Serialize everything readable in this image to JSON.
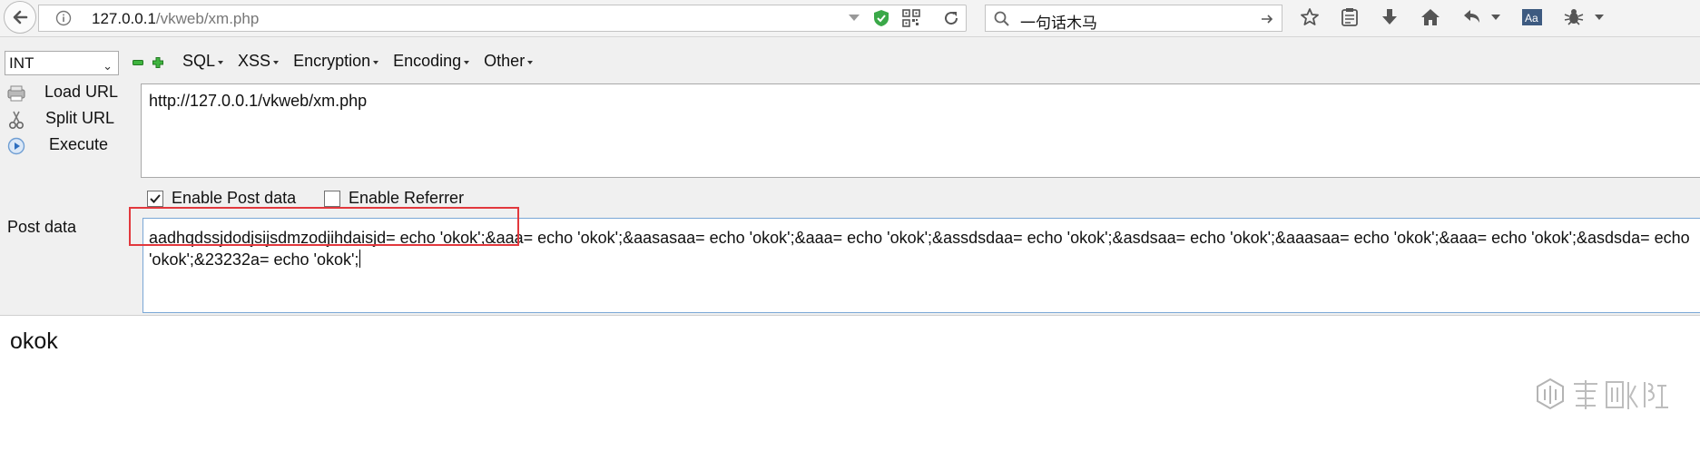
{
  "browser": {
    "url_host": "127.0.0.1",
    "url_path": "/vkweb/xm.php",
    "search_value": "一句话木马"
  },
  "hackbar": {
    "select_value": "INT",
    "menus": [
      "SQL",
      "XSS",
      "Encryption",
      "Encoding",
      "Other"
    ],
    "actions": {
      "load": "Load URL",
      "split": "Split URL",
      "execute": "Execute"
    },
    "url_value": "http://127.0.0.1/vkweb/xm.php",
    "enable_post_label": "Enable Post data",
    "enable_post_checked": true,
    "enable_referrer_label": "Enable Referrer",
    "enable_referrer_checked": false,
    "post_label": "Post data",
    "post_value": "aadhqdssjdodjsijsdmzodjihdaisjd= echo 'okok';&aaa= echo 'okok';&aasasaa= echo 'okok';&aaa= echo 'okok';&assdsdaa= echo 'okok';&asdsaa= echo 'okok';&aaasaa= echo 'okok';&aaa= echo 'okok';&asdsda= echo 'okok';&23232a= echo 'okok';"
  },
  "response": {
    "text": "okok"
  },
  "colors": {
    "highlight_box": "#e2383d",
    "shield_green": "#3aa848",
    "hackbar_bg": "#f0f0f0"
  },
  "icons": [
    "back-arrow-icon",
    "info-icon",
    "dropdown-arrow-icon",
    "shield-icon",
    "qr-code-icon",
    "reload-icon",
    "search-icon",
    "go-arrow-icon",
    "bookmark-star-icon",
    "reading-list-icon",
    "download-icon",
    "home-icon",
    "undo-icon",
    "reader-view-icon",
    "bug-icon"
  ]
}
